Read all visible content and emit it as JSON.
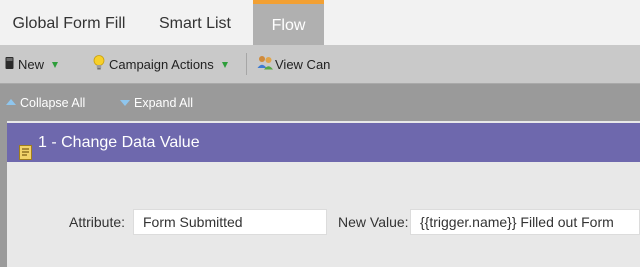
{
  "tabs": [
    {
      "label": "Global Form Fill",
      "active": false
    },
    {
      "label": "Smart List",
      "active": false
    },
    {
      "label": "Flow",
      "active": true
    }
  ],
  "toolbar": {
    "new_label": "New",
    "campaign_actions_label": "Campaign Actions",
    "view_label": "View Can"
  },
  "toolbar2": {
    "collapse_label": "Collapse All",
    "expand_label": "Expand All"
  },
  "step": {
    "title": "1 - Change Data Value",
    "attribute_label": "Attribute:",
    "attribute_value": "Form Submitted",
    "new_value_label": "New Value:",
    "new_value": "{{trigger.name}} Filled out Form"
  },
  "colors": {
    "active_tab_accent": "#f2a033",
    "step_header": "#6e68ad",
    "menu_caret": "#2e9e3b",
    "toolbar2_icon": "#8fc6ee"
  }
}
